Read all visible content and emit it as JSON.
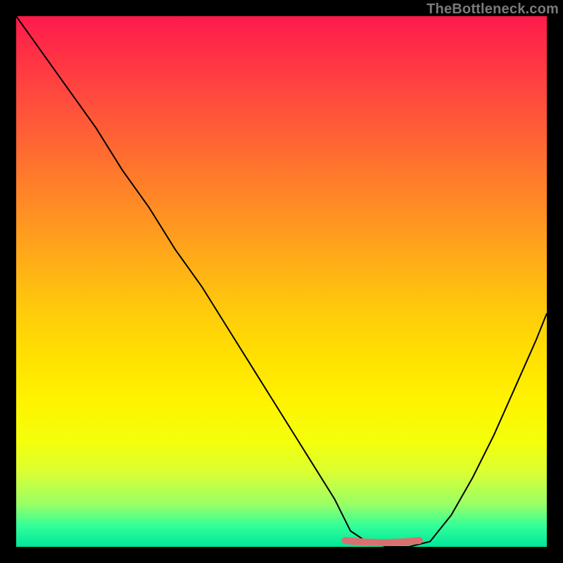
{
  "watermark": "TheBottleneck.com",
  "chart_data": {
    "type": "line",
    "title": "",
    "xlabel": "",
    "ylabel": "",
    "xlim": [
      0,
      100
    ],
    "ylim": [
      0,
      100
    ],
    "background_gradient": {
      "type": "vertical",
      "stops": [
        {
          "pos": 0,
          "color": "#ff1a4d"
        },
        {
          "pos": 50,
          "color": "#ffcc0b"
        },
        {
          "pos": 80,
          "color": "#fff200"
        },
        {
          "pos": 100,
          "color": "#00e699"
        }
      ]
    },
    "series": [
      {
        "name": "bottleneck-curve",
        "x": [
          0,
          5,
          10,
          15,
          20,
          25,
          30,
          35,
          40,
          45,
          50,
          55,
          60,
          63,
          66,
          70,
          74,
          78,
          82,
          86,
          90,
          94,
          98,
          100
        ],
        "y": [
          100,
          93,
          86,
          79,
          71,
          64,
          56,
          49,
          41,
          33,
          25,
          17,
          9,
          3,
          1,
          0,
          0,
          1,
          6,
          13,
          21,
          30,
          39,
          44
        ]
      }
    ],
    "annotations": [
      {
        "name": "optimal-flat-region",
        "type": "highlight-segment",
        "x_start": 62,
        "x_end": 76,
        "y": 0,
        "color": "#d97070"
      }
    ]
  }
}
